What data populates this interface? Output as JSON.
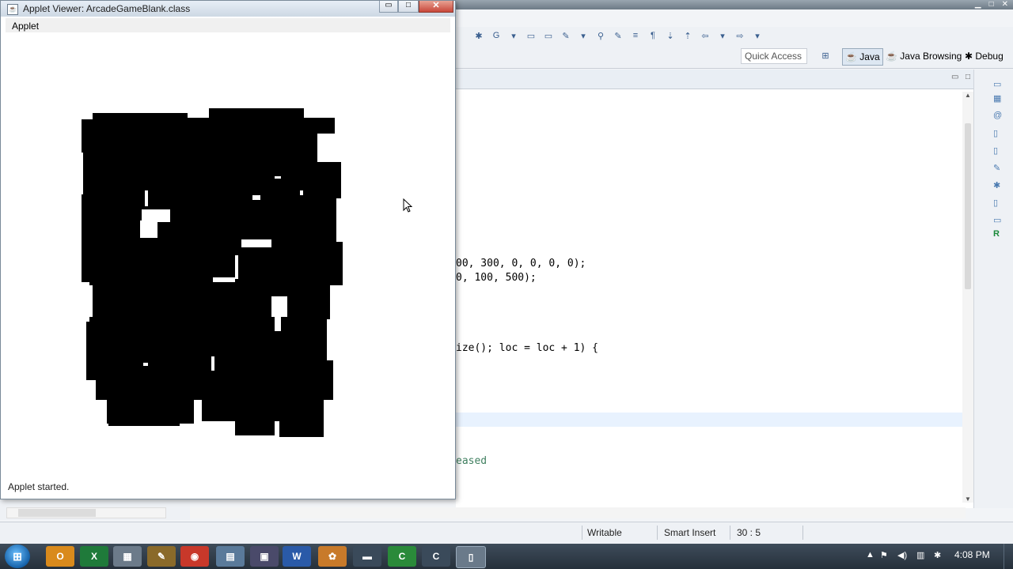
{
  "applet_window": {
    "title": "Applet Viewer: ArcadeGameBlank.class",
    "menu": "Applet",
    "status": "Applet started.",
    "controls": {
      "minimize": "▭",
      "maximize": "□",
      "close": "✕"
    }
  },
  "eclipse": {
    "quick_access": "Quick Access",
    "perspectives": {
      "java": "Java",
      "java_browsing": "Java Browsing",
      "debug": "Debug"
    },
    "code_lines": [
      "00, 300, 0, 0, 0, 0);",
      "0, 100, 500);",
      "ize(); loc = loc + 1) {",
      "eased"
    ],
    "status": {
      "writable": "Writable",
      "insert_mode": "Smart Insert",
      "position": "30 : 5"
    }
  },
  "taskbar": {
    "clock": "4:08 PM",
    "apps": [
      "outlook",
      "excel",
      "calculator",
      "tool",
      "chrome",
      "notepad",
      "visual-studio",
      "word",
      "paint",
      "media",
      "green-app",
      "c-app",
      "documents"
    ]
  },
  "colors": {
    "applet_bg": "#ffffff",
    "pixels": "#000000",
    "taskbar": "#2d3845"
  }
}
